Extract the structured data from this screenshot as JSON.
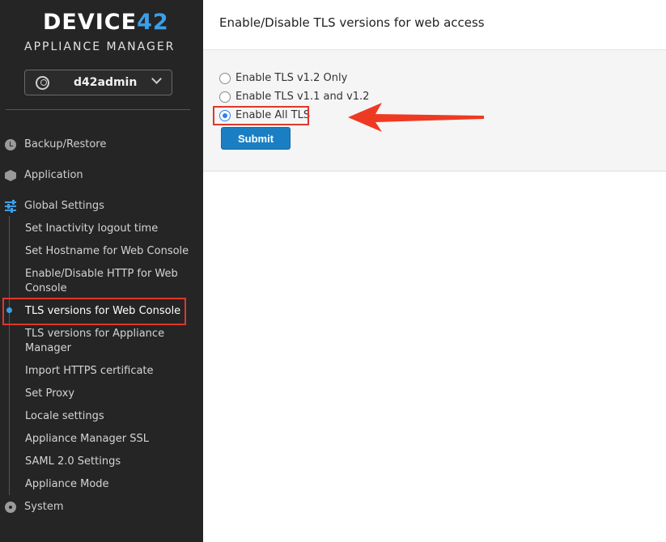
{
  "sidebar": {
    "logo_text": "DEVICE",
    "logo_number": "42",
    "app_title": "APPLIANCE MANAGER",
    "user": {
      "name": "d42admin",
      "icon": "user-circle-icon"
    },
    "sections": [
      {
        "label": "Backup/Restore",
        "icon": "clock-icon"
      },
      {
        "label": "Application",
        "icon": "cube-icon"
      },
      {
        "label": "Global Settings",
        "icon": "sliders-icon",
        "color": "#3aa0e8"
      },
      {
        "label": "System",
        "icon": "gear-icon"
      }
    ],
    "global_settings_items": [
      "Set Inactivity logout time",
      "Set Hostname for Web Console",
      "Enable/Disable HTTP for Web Console",
      "TLS versions for Web Console",
      "TLS versions for Appliance Manager",
      "Import HTTPS certificate",
      "Set Proxy",
      "Locale settings",
      "Appliance Manager SSL",
      "SAML 2.0 Settings",
      "Appliance Mode"
    ],
    "active_item": "TLS versions for Web Console"
  },
  "main": {
    "title": "Enable/Disable TLS versions for web access",
    "options": [
      {
        "label": "Enable TLS v1.2 Only",
        "checked": false
      },
      {
        "label": "Enable TLS v1.1 and v1.2",
        "checked": false
      },
      {
        "label": "Enable All TLS",
        "checked": true
      }
    ],
    "submit_label": "Submit"
  },
  "colors": {
    "accent": "#3aa0e8",
    "highlight": "#e0362c",
    "button": "#1a7fc2",
    "sidebar_bg": "#252525"
  }
}
